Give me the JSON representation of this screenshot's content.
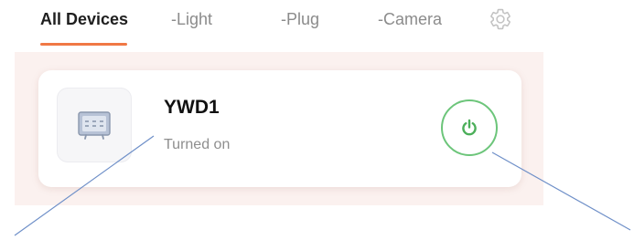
{
  "tabs": {
    "all_devices": "All Devices",
    "light": "-Light",
    "plug": "-Plug",
    "camera": "-Camera"
  },
  "device": {
    "name": "YWD1",
    "status": "Turned on",
    "icon": "device-panel-icon"
  },
  "icons": {
    "settings": "gear-icon",
    "power": "power-icon"
  },
  "colors": {
    "active_tab_underline": "#f07845",
    "power_accent": "#6cc57a",
    "panel_background": "#fbf1ef"
  }
}
